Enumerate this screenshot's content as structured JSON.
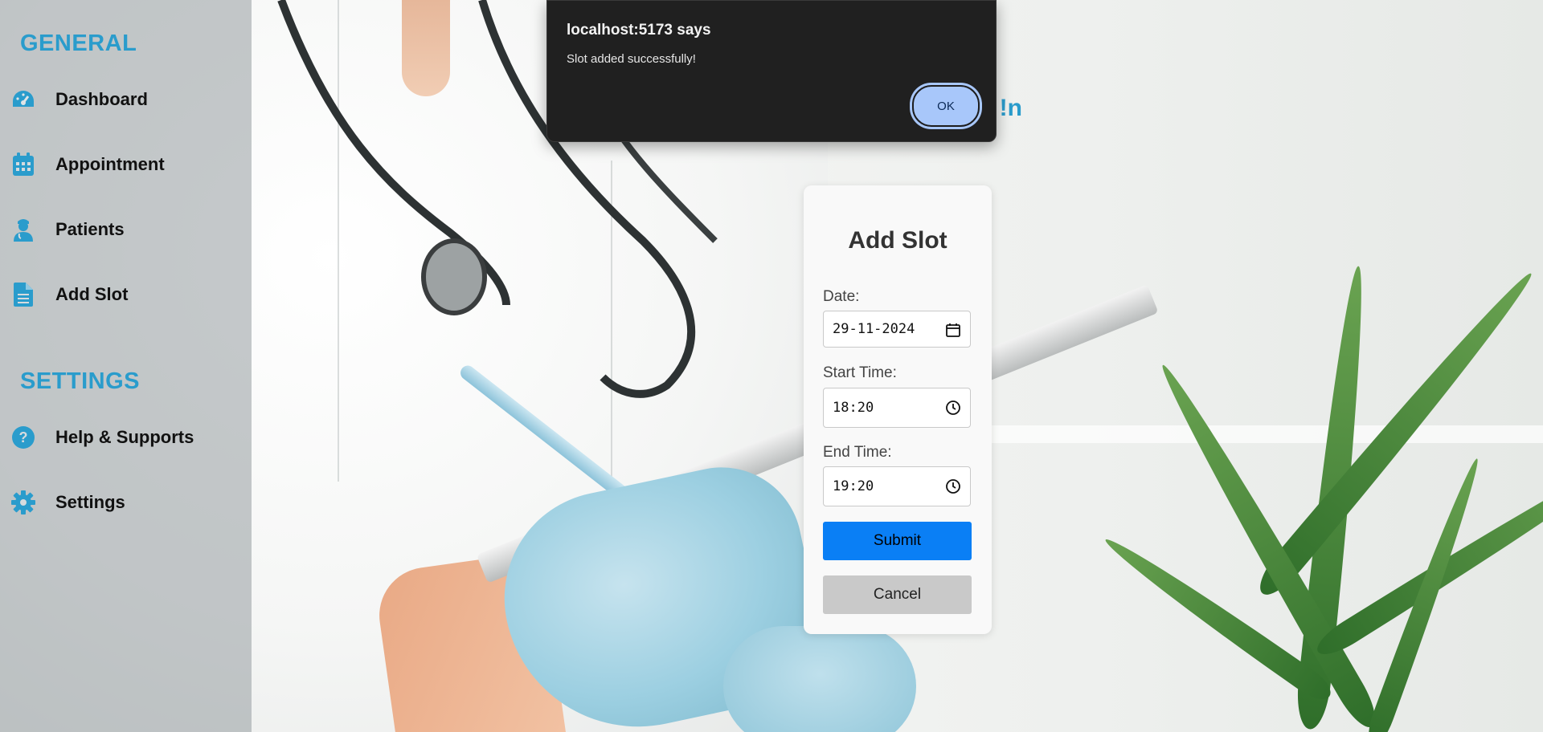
{
  "sidebar": {
    "general_title": "GENERAL",
    "settings_title": "SETTINGS",
    "items": [
      {
        "label": "Dashboard",
        "icon": "dashboard-gauge-icon"
      },
      {
        "label": "Appointment",
        "icon": "calendar-icon"
      },
      {
        "label": "Patients",
        "icon": "doctor-user-icon"
      },
      {
        "label": "Add Slot",
        "icon": "document-icon"
      },
      {
        "label": "Help & Supports",
        "icon": "question-circle-icon"
      },
      {
        "label": "Settings",
        "icon": "gear-icon"
      }
    ]
  },
  "main": {
    "welcome_fragment": "n!"
  },
  "add_slot_form": {
    "title": "Add Slot",
    "date_label": "Date:",
    "date_value": "29-11-2024",
    "start_label": "Start Time:",
    "start_value": "18:20",
    "end_label": "End Time:",
    "end_value": "19:20",
    "submit_label": "Submit",
    "cancel_label": "Cancel"
  },
  "alert_dialog": {
    "title": "localhost:5173 says",
    "message": "Slot added successfully!",
    "ok_label": "OK"
  },
  "colors": {
    "accent": "#2a9ccc",
    "submit": "#0a7ff5",
    "cancel": "#c9c9c9",
    "dialog_bg": "#202020",
    "dialog_button": "#a8c7fa"
  }
}
